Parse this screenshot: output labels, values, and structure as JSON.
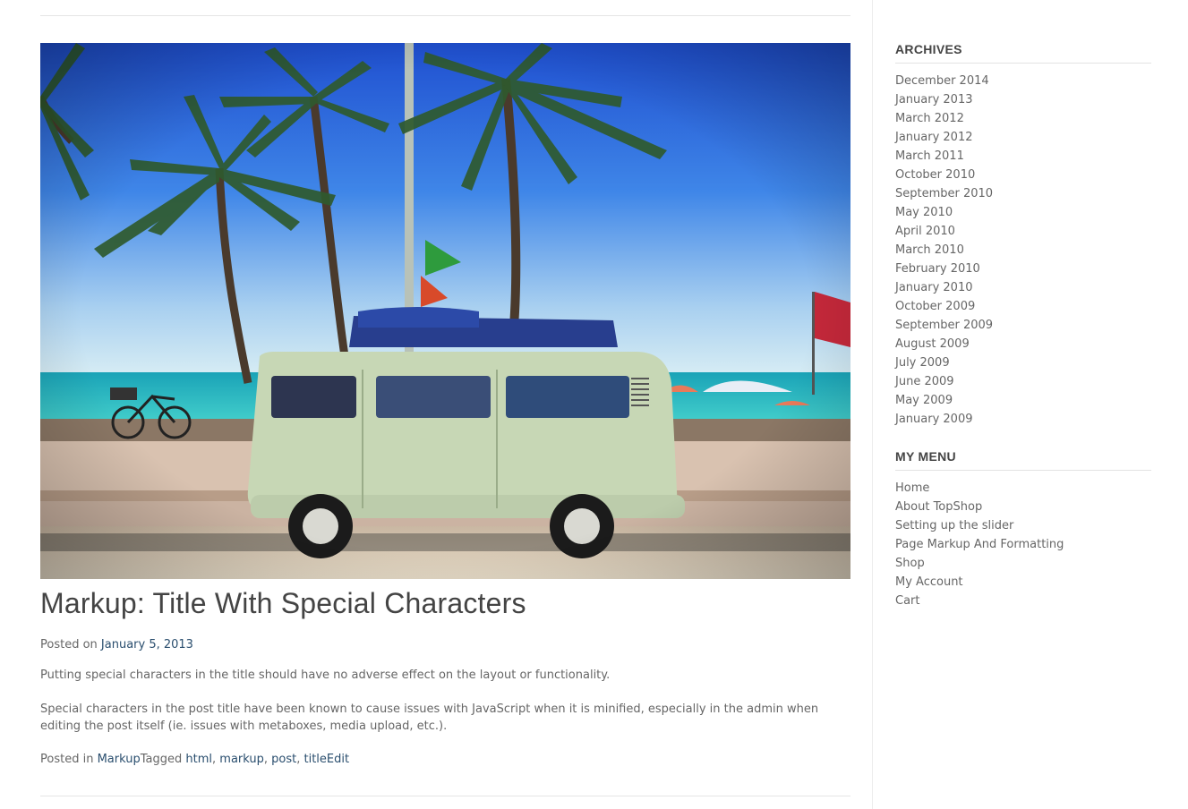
{
  "post": {
    "title": "Markup: Title With Special Characters",
    "posted_on_label": "Posted on ",
    "date": "January 5, 2013",
    "paragraphs": [
      "Putting special characters in the title should have no adverse effect on the layout or functionality.",
      "Special characters in the post title have been known to cause issues with JavaScript when it is minified, especially in the admin when editing the post itself (ie. issues with metaboxes, media upload, etc.)."
    ],
    "footer": {
      "posted_in_label": "Posted in ",
      "category": "Markup",
      "tagged_label": "Tagged ",
      "tags": [
        "html",
        "markup",
        "post",
        "title"
      ],
      "edit_label": "Edit"
    }
  },
  "sidebar": {
    "archives": {
      "title": "ARCHIVES",
      "items": [
        "December 2014",
        "January 2013",
        "March 2012",
        "January 2012",
        "March 2011",
        "October 2010",
        "September 2010",
        "May 2010",
        "April 2010",
        "March 2010",
        "February 2010",
        "January 2010",
        "October 2009",
        "September 2009",
        "August 2009",
        "July 2009",
        "June 2009",
        "May 2009",
        "January 2009"
      ]
    },
    "menu": {
      "title": "MY MENU",
      "items": [
        "Home",
        "About TopShop",
        "Setting up the slider",
        "Page Markup And Formatting",
        "Shop",
        "My Account",
        "Cart"
      ]
    }
  },
  "colors": {
    "link": "#2a4e6e",
    "text": "#666666",
    "heading": "#444444"
  }
}
